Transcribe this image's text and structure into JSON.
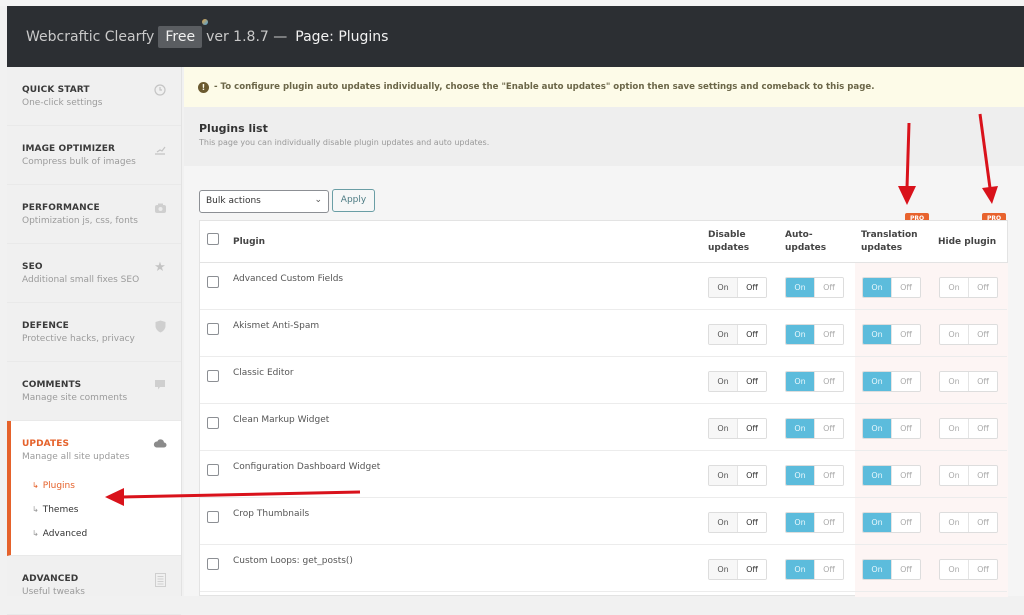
{
  "header": {
    "brand": "Webcraftic Clearfy",
    "edition_badge": "Free",
    "version": "ver 1.8.7 —",
    "page_title": "Page: Plugins"
  },
  "sidebar": {
    "items": [
      {
        "title": "QUICK START",
        "subtitle": "One-click settings",
        "icon": "clock-icon"
      },
      {
        "title": "IMAGE OPTIMIZER",
        "subtitle": "Compress bulk of images",
        "icon": "image-chart-icon"
      },
      {
        "title": "PERFORMANCE",
        "subtitle": "Optimization js, css, fonts",
        "icon": "camera-icon"
      },
      {
        "title": "SEO",
        "subtitle": "Additional small fixes SEO",
        "icon": "star-icon"
      },
      {
        "title": "DEFENCE",
        "subtitle": "Protective hacks, privacy",
        "icon": "shield-icon"
      },
      {
        "title": "COMMENTS",
        "subtitle": "Manage site comments",
        "icon": "comment-icon"
      },
      {
        "title": "UPDATES",
        "subtitle": "Manage all site updates",
        "icon": "cloud-icon",
        "active": true
      },
      {
        "title": "ADVANCED",
        "subtitle": "Useful tweaks",
        "icon": "document-icon"
      }
    ],
    "submenu": [
      {
        "label": "Plugins",
        "current": true
      },
      {
        "label": "Themes"
      },
      {
        "label": "Advanced"
      }
    ]
  },
  "notice": {
    "icon": "warning-icon",
    "text": "- To configure plugin auto updates individually, choose the \"Enable auto updates\" option then save settings and comeback to this page."
  },
  "plugins_section": {
    "title": "Plugins list",
    "description": "This page you can individually disable plugin updates and auto updates."
  },
  "toolbar": {
    "bulk_actions": "Bulk actions",
    "apply_label": "Apply"
  },
  "table": {
    "columns": {
      "plugin": "Plugin",
      "disable_updates": "Disable updates",
      "auto_updates": "Auto- updates",
      "translation_updates": "Translation updates",
      "hide_plugin": "Hide plugin"
    },
    "pro_badge": "PRO",
    "toggle_on": "On",
    "toggle_off": "Off",
    "rows": [
      {
        "name": "Advanced Custom Fields",
        "disable_updates": "off",
        "auto_updates": "on",
        "translation_updates": "on",
        "hide_plugin": "off"
      },
      {
        "name": "Akismet Anti-Spam",
        "disable_updates": "off",
        "auto_updates": "on",
        "translation_updates": "on",
        "hide_plugin": "off"
      },
      {
        "name": "Classic Editor",
        "disable_updates": "off",
        "auto_updates": "on",
        "translation_updates": "on",
        "hide_plugin": "off"
      },
      {
        "name": "Clean Markup Widget",
        "disable_updates": "off",
        "auto_updates": "on",
        "translation_updates": "on",
        "hide_plugin": "off"
      },
      {
        "name": "Configuration Dashboard Widget",
        "disable_updates": "off",
        "auto_updates": "on",
        "translation_updates": "on",
        "hide_plugin": "off"
      },
      {
        "name": "Crop Thumbnails",
        "disable_updates": "off",
        "auto_updates": "on",
        "translation_updates": "on",
        "hide_plugin": "off"
      },
      {
        "name": "Custom Loops: get_posts()",
        "disable_updates": "off",
        "auto_updates": "on",
        "translation_updates": "on",
        "hide_plugin": "off"
      }
    ]
  },
  "colors": {
    "accent": "#e5622b",
    "toggle_active": "#5cbcdc",
    "annotation_arrow": "#d9121b",
    "header_bg": "#2c2f33"
  }
}
